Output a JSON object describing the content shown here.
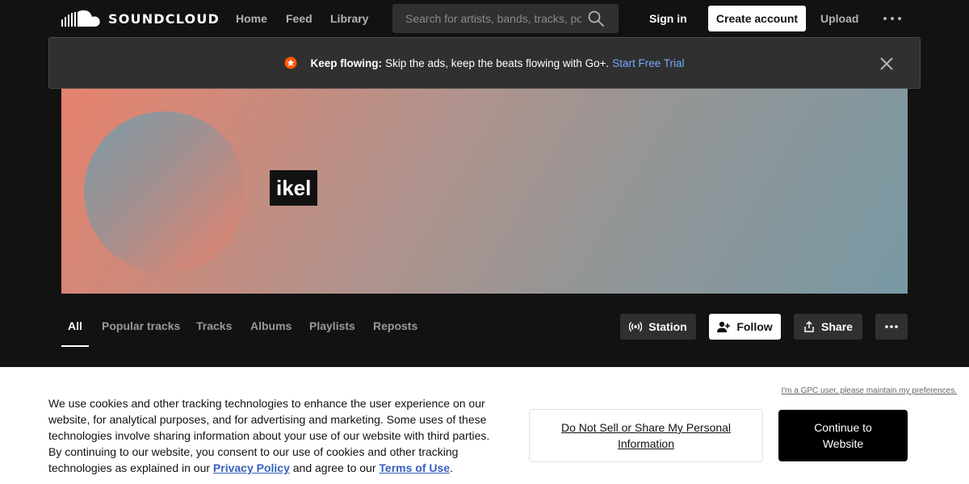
{
  "brand": {
    "name": "SOUNDCLOUD",
    "accent": "#ff5500"
  },
  "nav": {
    "links": [
      "Home",
      "Feed",
      "Library"
    ],
    "search_placeholder": "Search for artists, bands, tracks, podcasts",
    "sign_in": "Sign in",
    "create_account": "Create account",
    "upload": "Upload"
  },
  "banner": {
    "title": "Keep flowing:",
    "message": "Skip the ads, keep the beats flowing with Go+.",
    "cta": "Start Free Trial"
  },
  "profile": {
    "name": "ikel"
  },
  "tabs": [
    "All",
    "Popular tracks",
    "Tracks",
    "Albums",
    "Playlists",
    "Reposts"
  ],
  "actions": {
    "station": "Station",
    "follow": "Follow",
    "share": "Share"
  },
  "cookie": {
    "text_before": "We use cookies and other tracking technologies to enhance the user experience on our website, for analytical purposes, and for advertising and marketing. Some uses of these technologies involve sharing information about your use of our website with third parties. By continuing to our website, you consent to our use of cookies and other tracking technologies as explained in our ",
    "privacy_policy": "Privacy Policy",
    "text_middle": " and agree to our ",
    "terms_of_use": "Terms of Use",
    "text_after": ".",
    "gpc_link": "I'm a GPC user, please maintain my preferences.",
    "do_not_sell": "Do Not Sell or Share My Personal Information",
    "continue": "Continue to Website"
  }
}
